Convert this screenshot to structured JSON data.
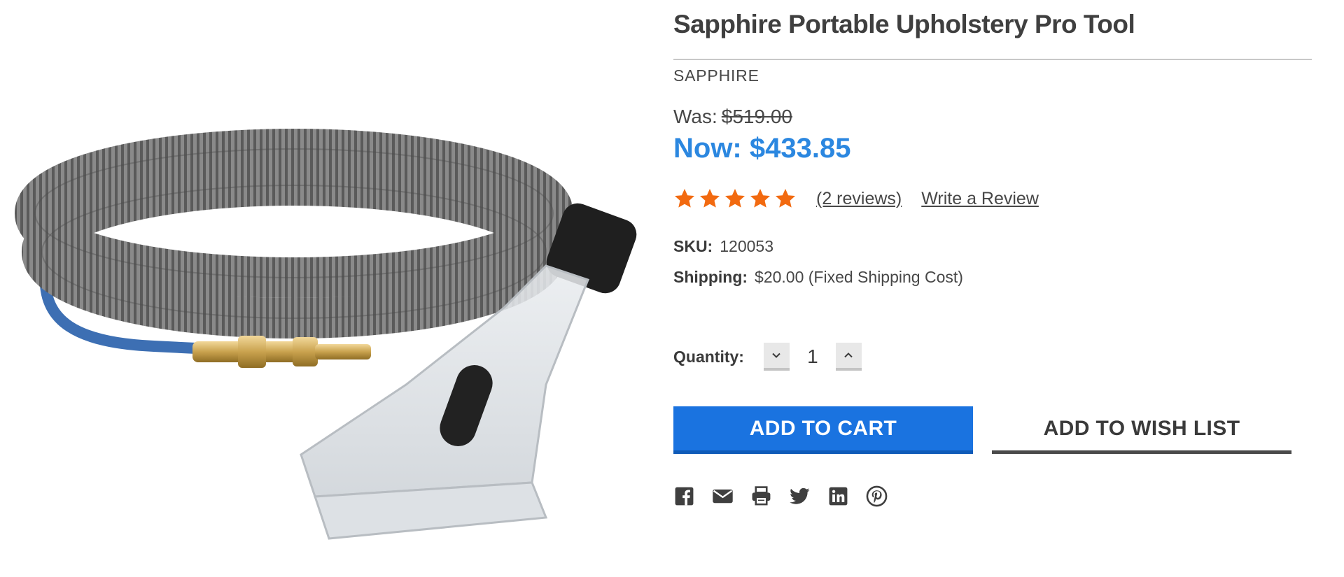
{
  "product": {
    "title": "Sapphire Portable Upholstery Pro Tool",
    "brand": "SAPPHIRE",
    "image_alt": "Upholstery tool with coiled vacuum and solution hoses"
  },
  "price": {
    "was_label": "Was:",
    "was_value": "$519.00",
    "now": "Now: $433.85"
  },
  "rating": {
    "stars": 5,
    "star_color": "#f26a10",
    "reviews_link": "(2 reviews)",
    "write_review": "Write a Review"
  },
  "info": {
    "sku_label": "SKU:",
    "sku_value": "120053",
    "shipping_label": "Shipping:",
    "shipping_value": "$20.00 (Fixed Shipping Cost)"
  },
  "quantity": {
    "label": "Quantity:",
    "value": "1",
    "decrease_icon": "chevron-down-icon",
    "increase_icon": "chevron-up-icon"
  },
  "actions": {
    "add_to_cart": "ADD TO CART",
    "add_to_wishlist": "ADD TO WISH LIST"
  },
  "share": {
    "icons": [
      "facebook-icon",
      "email-icon",
      "print-icon",
      "twitter-icon",
      "linkedin-icon",
      "pinterest-icon"
    ]
  },
  "colors": {
    "accent_blue": "#1a73e0",
    "price_blue": "#2b87e0",
    "text_dark": "#3a3a3a"
  }
}
